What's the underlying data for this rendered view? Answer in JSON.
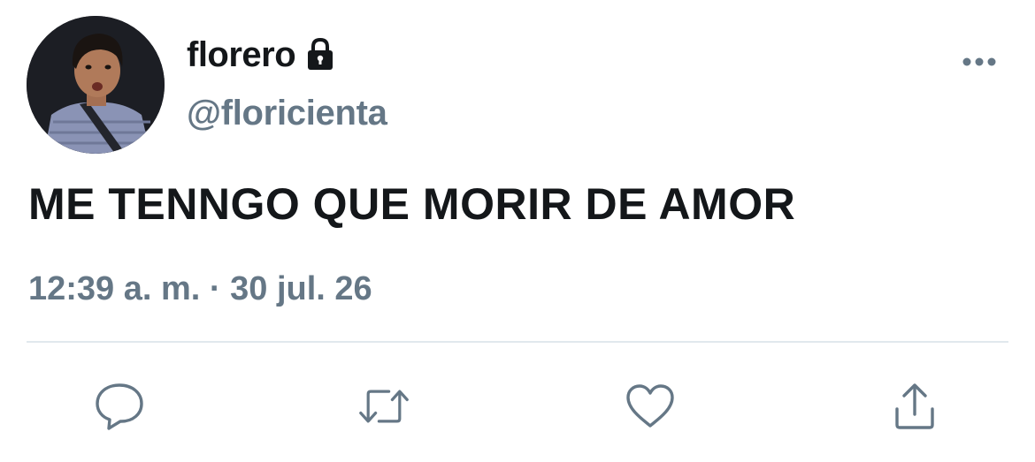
{
  "tweet": {
    "display_name": "florero",
    "handle": "@floricienta",
    "text": "ME TENNGO QUE MORIR DE AMOR",
    "time": "12:39 a. m.",
    "separator": "·",
    "date": "30 jul. 26"
  },
  "icons": {
    "lock": "lock-icon",
    "more": "more-dots-icon",
    "reply": "reply-icon",
    "retweet": "retweet-icon",
    "like": "heart-icon",
    "share": "share-icon"
  },
  "colors": {
    "text_primary": "#14171a",
    "text_secondary": "#657786",
    "divider": "#e1e8ed"
  }
}
